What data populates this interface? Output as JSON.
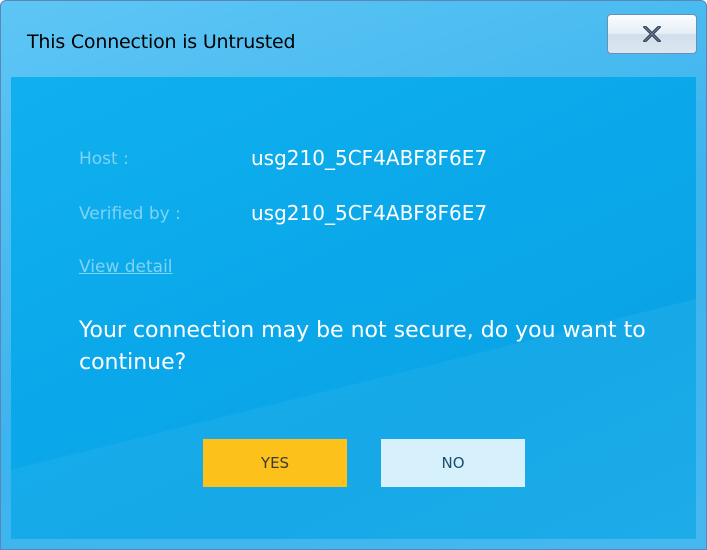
{
  "window": {
    "title": "This Connection is Untrusted",
    "close_icon": "close-x-icon"
  },
  "details": {
    "host_label": "Host :",
    "host_value": "usg210_5CF4ABF8F6E7",
    "verified_label": "Verified by :",
    "verified_value": "usg210_5CF4ABF8F6E7",
    "view_detail_link": "View detail"
  },
  "message": "Your connection may be not secure, do you want to continue?",
  "buttons": {
    "yes_label": "YES",
    "no_label": "NO"
  },
  "colors": {
    "accent_yes": "#fcc21b",
    "accent_no": "#d6f1fc",
    "panel": "#0aa8ea"
  }
}
